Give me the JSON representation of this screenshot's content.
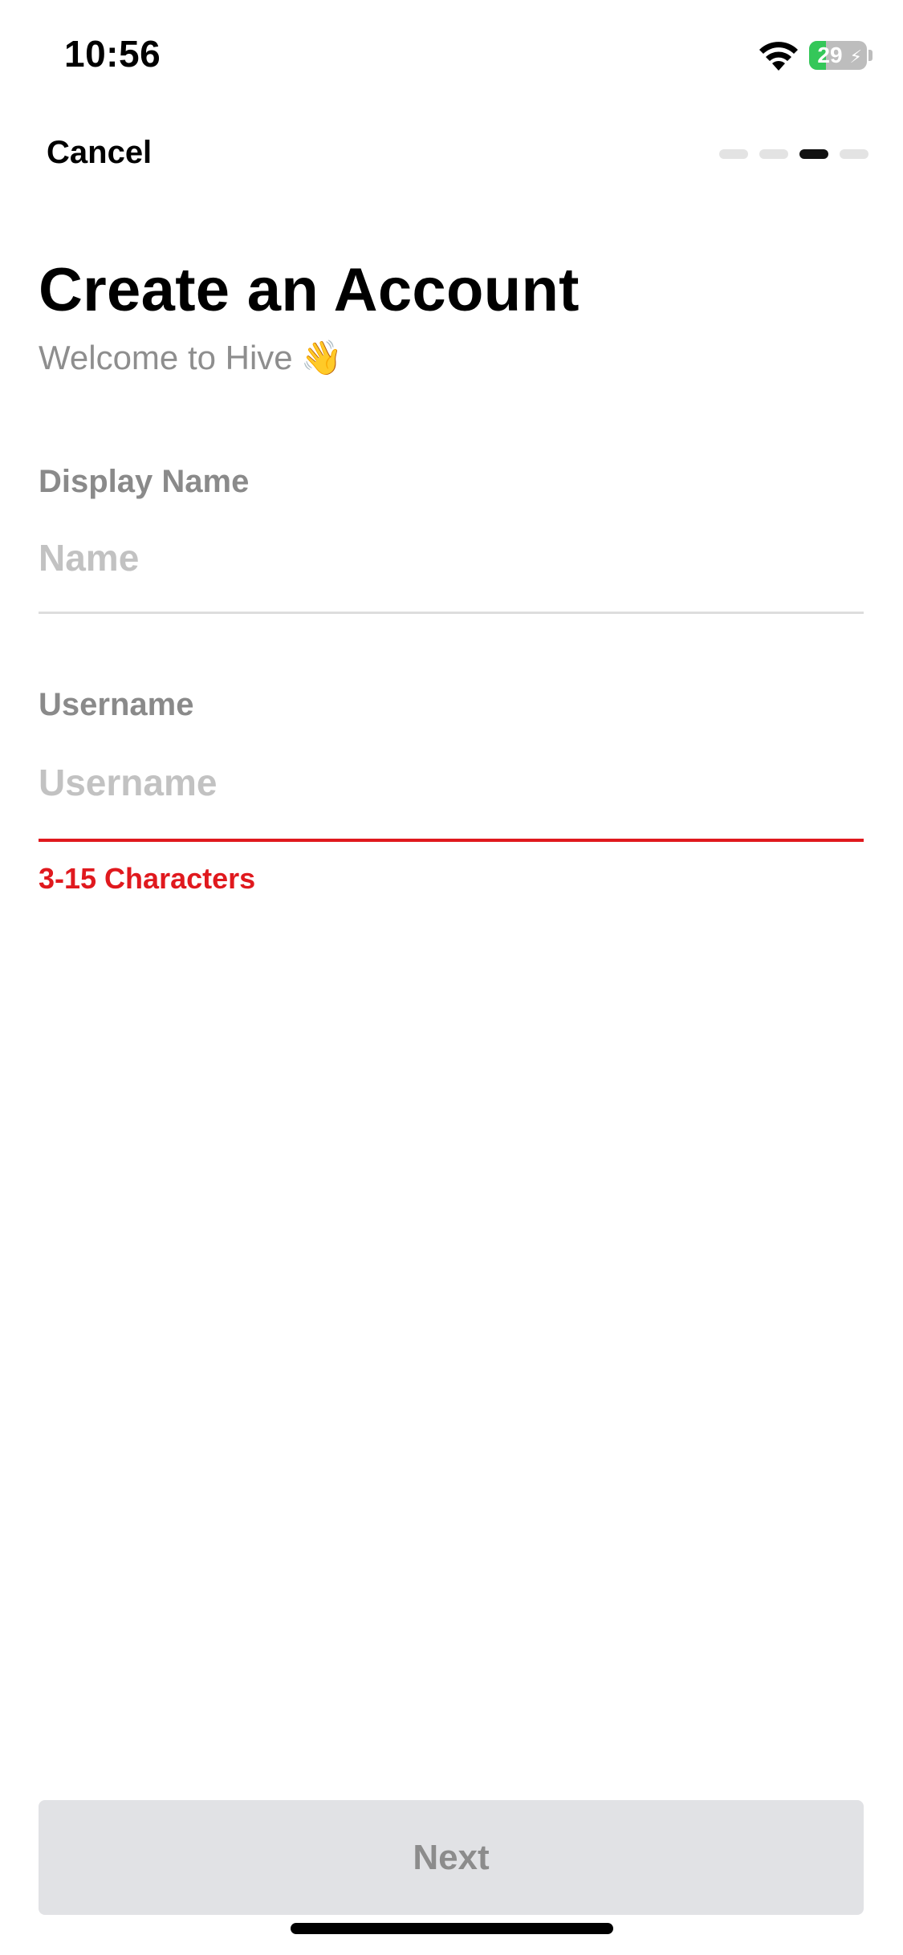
{
  "status_bar": {
    "time": "10:56",
    "battery_level": "29",
    "battery_charging": true,
    "wifi_icon": "wifi-icon"
  },
  "nav": {
    "cancel_label": "Cancel",
    "progress": {
      "total_steps": 4,
      "current_step": 3
    }
  },
  "header": {
    "title": "Create an Account",
    "subtitle": "Welcome to Hive",
    "subtitle_emoji": "👋"
  },
  "form": {
    "display_name": {
      "label": "Display Name",
      "placeholder": "Name",
      "value": ""
    },
    "username": {
      "label": "Username",
      "placeholder": "Username",
      "value": "",
      "error": "3-15 Characters"
    }
  },
  "footer": {
    "next_label": "Next"
  },
  "colors": {
    "error": "#e0191e",
    "button_disabled_bg": "#e1e2e5",
    "label_gray": "#8a8a8a",
    "placeholder_gray": "#c2c2c2",
    "battery_green": "#34c759"
  }
}
